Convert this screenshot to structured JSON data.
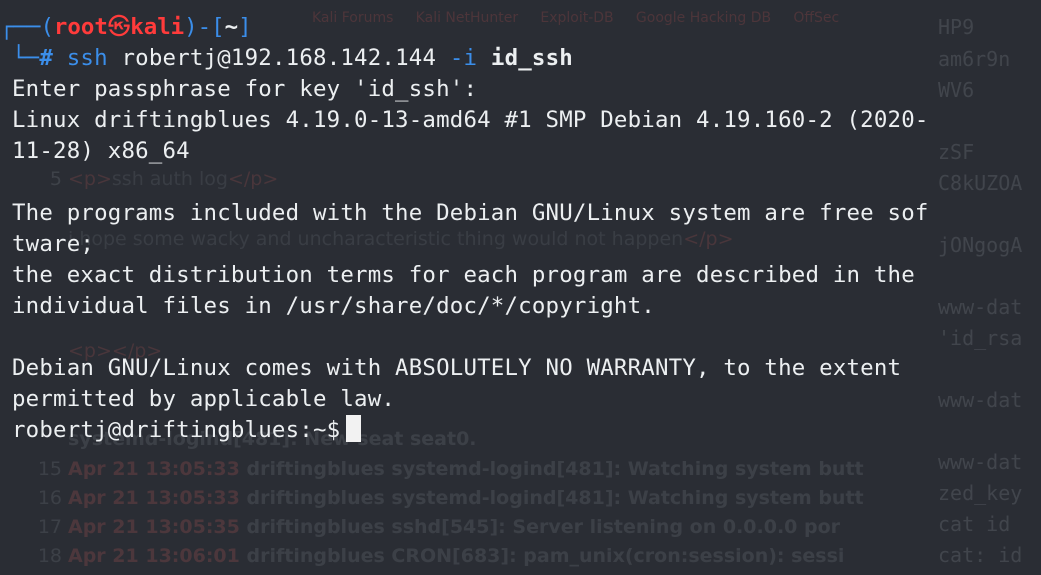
{
  "window": {
    "accent": "#3b8eea",
    "root_color": "#ff3b3b",
    "text_color": "#eceff1",
    "background": "#2a2d34"
  },
  "prompt": {
    "user": "root",
    "skull_glyph": "㉿",
    "host": "kali",
    "cwd": "~",
    "hash": "#",
    "command_bin": "ssh",
    "command_target": "robertj@192.168.142.144",
    "command_flag": "-i",
    "command_file": "id_ssh"
  },
  "output": {
    "passphrase_prompt": "Enter passphrase for key 'id_ssh':",
    "uname_1": "Linux driftingblues 4.19.0-13-amd64 #1 SMP Debian 4.19.160-2 (2020-",
    "uname_2": "11-28) x86_64",
    "motd_1": "The programs included with the Debian GNU/Linux system are free sof",
    "motd_2": "tware;",
    "motd_3": "the exact distribution terms for each program are described in the",
    "motd_4": "individual files in /usr/share/doc/*/copyright.",
    "warranty_1": "Debian GNU/Linux comes with ABSOLUTELY NO WARRANTY, to the extent",
    "warranty_2": "permitted by applicable law.",
    "remote_prompt": "robertj@driftingblues:~$"
  }
}
